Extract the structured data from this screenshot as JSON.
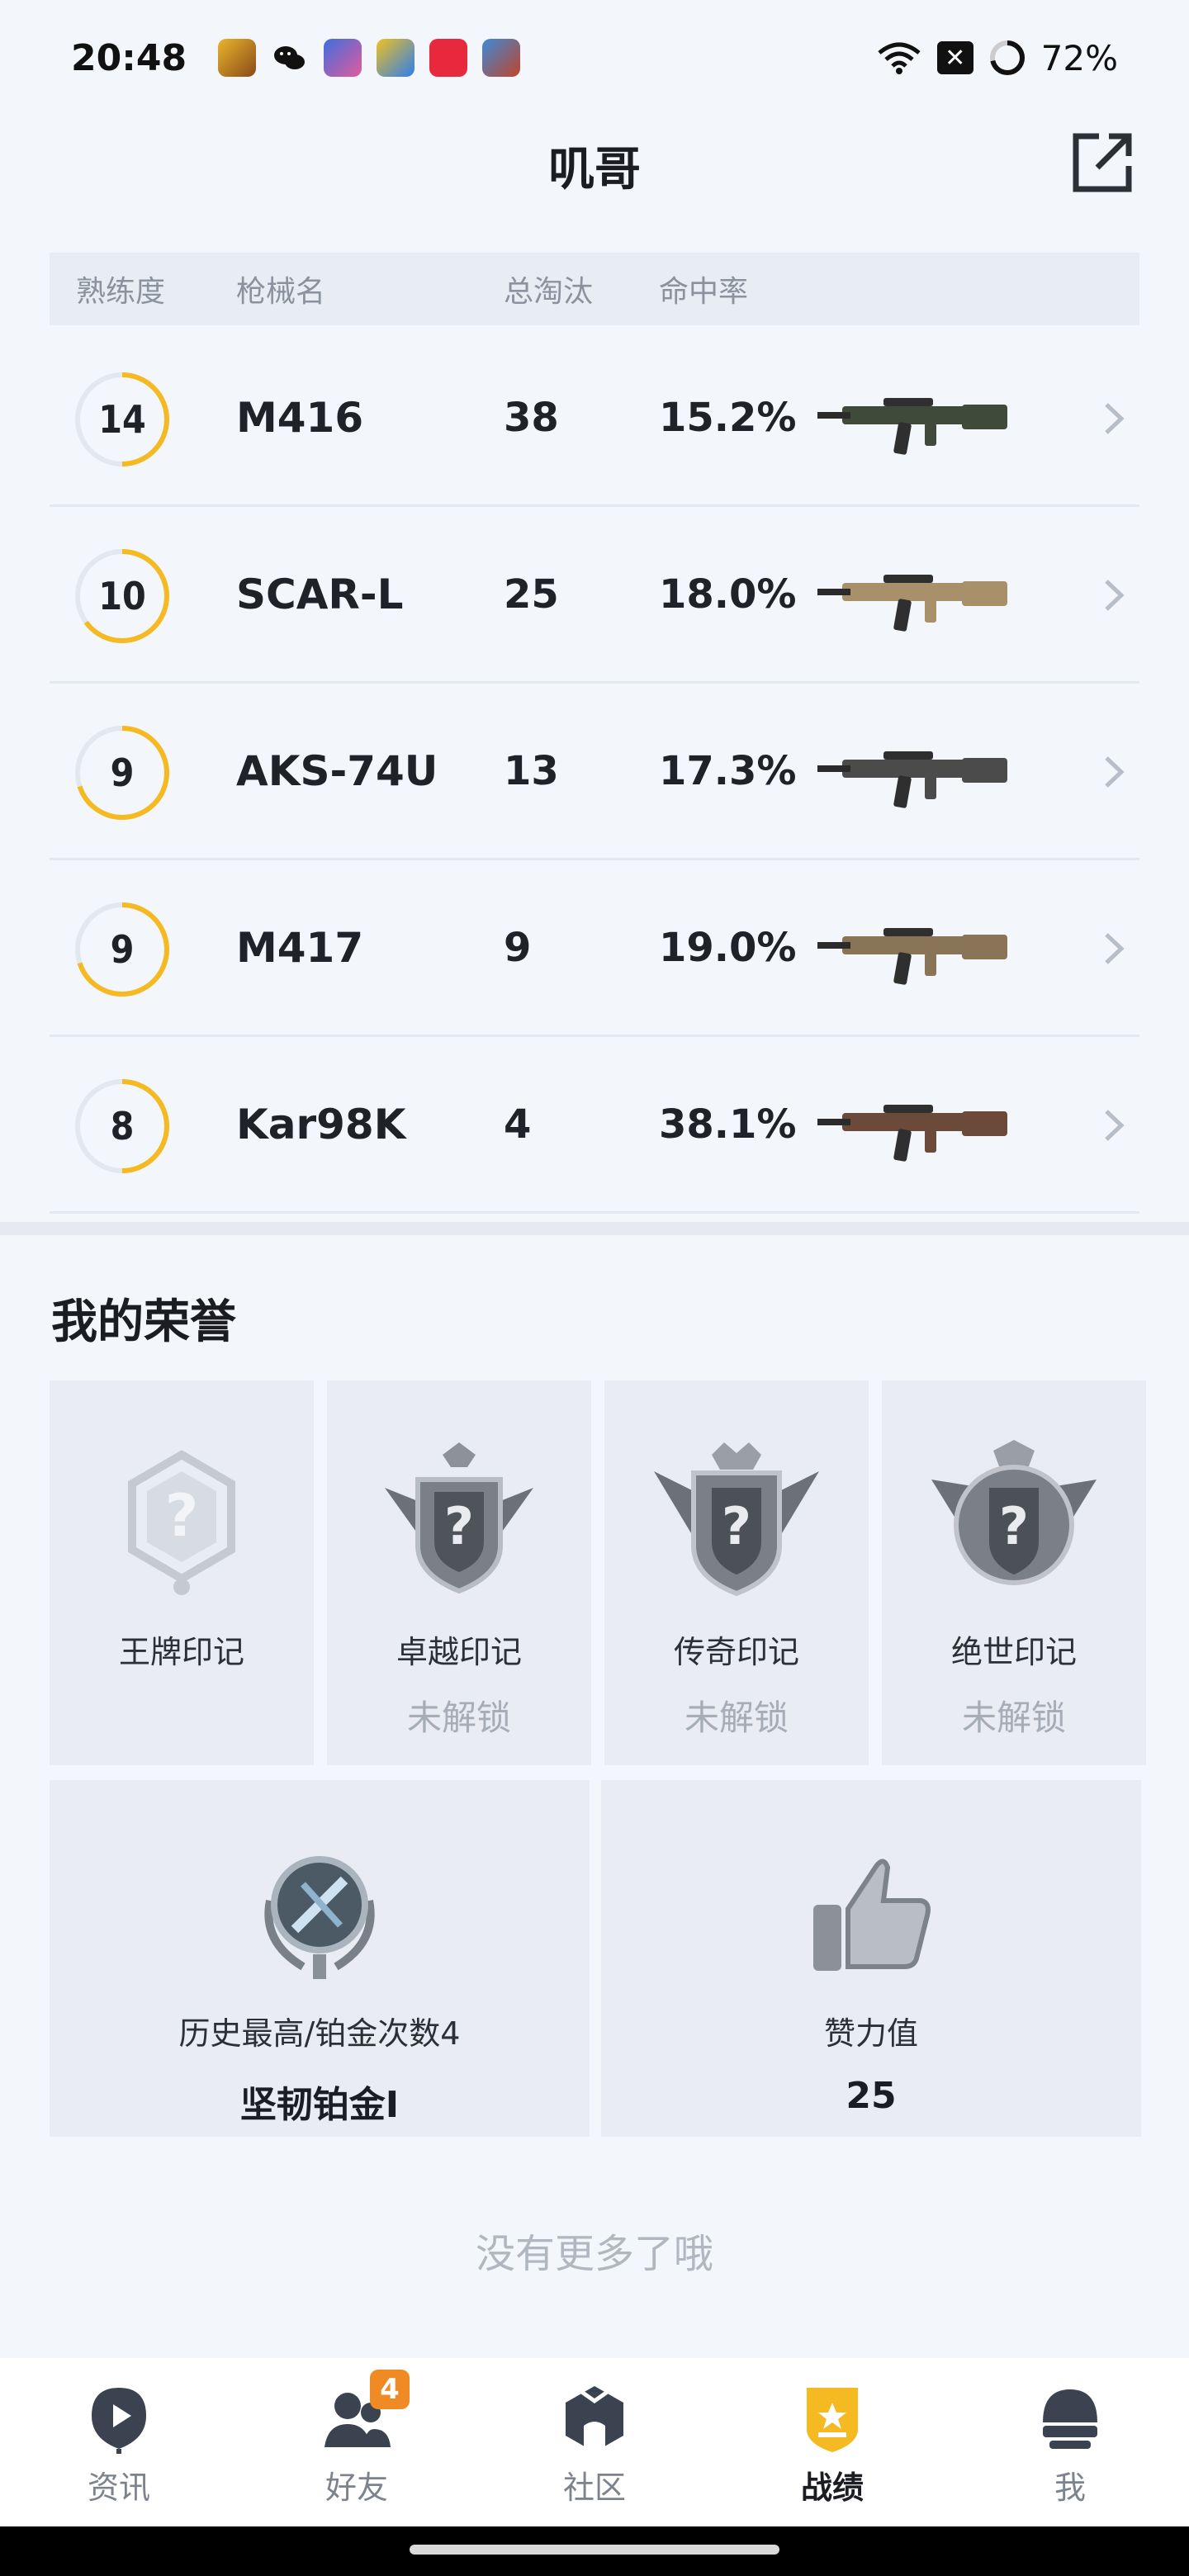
{
  "status_bar": {
    "time": "20:48",
    "battery": "72%",
    "notif_icons": [
      "game-app-icon",
      "wechat-icon",
      "game-app-icon-2",
      "star-app-icon",
      "music-app-icon",
      "game-app-icon-3"
    ]
  },
  "header": {
    "title": "叽哥",
    "share_icon": "share-export-icon"
  },
  "table": {
    "columns": [
      "熟练度",
      "枪械名",
      "总淘汰",
      "命中率"
    ],
    "rows": [
      {
        "proficiency": "14",
        "name": "M416",
        "kills": "38",
        "accuracy": "15.2%",
        "progress": 0.5,
        "weapon_color": "#3f4a3a"
      },
      {
        "proficiency": "10",
        "name": "SCAR-L",
        "kills": "25",
        "accuracy": "18.0%",
        "progress": 0.65,
        "weapon_color": "#a8916a"
      },
      {
        "proficiency": "9",
        "name": "AKS-74U",
        "kills": "13",
        "accuracy": "17.3%",
        "progress": 0.7,
        "weapon_color": "#4b4b4b"
      },
      {
        "proficiency": "9",
        "name": "M417",
        "kills": "9",
        "accuracy": "19.0%",
        "progress": 0.7,
        "weapon_color": "#8a7458"
      },
      {
        "proficiency": "8",
        "name": "Kar98K",
        "kills": "4",
        "accuracy": "38.1%",
        "progress": 0.5,
        "weapon_color": "#6b4a3a"
      }
    ]
  },
  "honor": {
    "title": "我的荣誉",
    "seals": [
      {
        "name": "王牌印记",
        "status": ""
      },
      {
        "name": "卓越印记",
        "status": "未解锁"
      },
      {
        "name": "传奇印记",
        "status": "未解锁"
      },
      {
        "name": "绝世印记",
        "status": "未解锁"
      }
    ],
    "rank_card": {
      "label": "历史最高/铂金次数4",
      "value": "坚韧铂金I"
    },
    "likes_card": {
      "label": "赞力值",
      "value": "25"
    }
  },
  "footer_text": "没有更多了哦",
  "nav": {
    "items": [
      {
        "label": "资讯",
        "icon": "news-icon"
      },
      {
        "label": "好友",
        "icon": "friends-icon",
        "badge": "4"
      },
      {
        "label": "社区",
        "icon": "community-icon"
      },
      {
        "label": "战绩",
        "icon": "stats-icon",
        "active": true
      },
      {
        "label": "我",
        "icon": "profile-helmet-icon"
      }
    ]
  },
  "colors": {
    "accent": "#f5b921",
    "background": "#f3f6fb",
    "badge": "#f08a24"
  }
}
